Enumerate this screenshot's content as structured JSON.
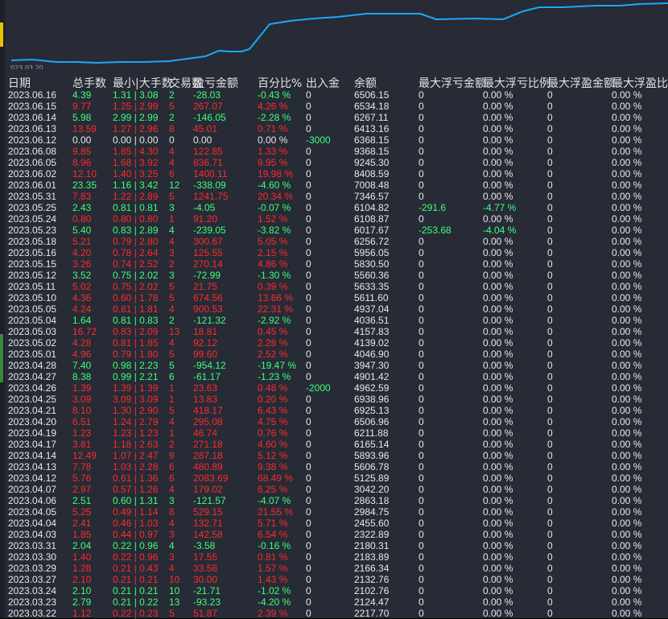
{
  "chart": {
    "x_label": "023.03.20",
    "line_color": "#1ea7ff",
    "points": [
      [
        14,
        75
      ],
      [
        40,
        74
      ],
      [
        70,
        77
      ],
      [
        95,
        77
      ],
      [
        120,
        78
      ],
      [
        150,
        77
      ],
      [
        180,
        77
      ],
      [
        210,
        76
      ],
      [
        240,
        72
      ],
      [
        255,
        70
      ],
      [
        272,
        63
      ],
      [
        285,
        64
      ],
      [
        300,
        64
      ],
      [
        310,
        61
      ],
      [
        335,
        30
      ],
      [
        360,
        26
      ],
      [
        390,
        23
      ],
      [
        420,
        21
      ],
      [
        455,
        17
      ],
      [
        490,
        17
      ],
      [
        522,
        17
      ],
      [
        542,
        24
      ],
      [
        590,
        23
      ],
      [
        625,
        24
      ],
      [
        650,
        14
      ],
      [
        670,
        9
      ],
      [
        700,
        9
      ],
      [
        740,
        7
      ],
      [
        770,
        7
      ],
      [
        795,
        5
      ],
      [
        830,
        4
      ]
    ]
  },
  "header": [
    "日期",
    "总手数",
    "最小|大手数",
    "交易数",
    "盈亏金额",
    "百分比%",
    "出入金",
    "余额",
    "最大浮亏金额",
    "最大浮亏比例",
    "最大浮盈金额",
    "最大浮盈比例"
  ],
  "rows": [
    [
      "2023.06.16",
      "4.39",
      "1.31 | 3.08",
      "2",
      "-28.03",
      "-0.43 %",
      "0",
      "6506.15",
      "0",
      "0.00 %",
      "0",
      "0.00 %"
    ],
    [
      "2023.06.15",
      "9.77",
      "1.25 | 2.99",
      "5",
      "267.07",
      "4.26 %",
      "0",
      "6534.18",
      "0",
      "0.00 %",
      "0",
      "0.00 %"
    ],
    [
      "2023.06.14",
      "5.98",
      "2.99 | 2.99",
      "2",
      "-146.05",
      "-2.28 %",
      "0",
      "6267.11",
      "0",
      "0.00 %",
      "0",
      "0.00 %"
    ],
    [
      "2023.06.13",
      "13.59",
      "1.27 | 2.96",
      "8",
      "45.01",
      "0.71 %",
      "0",
      "6413.16",
      "0",
      "0.00 %",
      "0",
      "0.00 %"
    ],
    [
      "2023.06.12",
      "0.00",
      "0.00 | 0.00",
      "0",
      "0.00",
      "0.00 %",
      "-3000",
      "6368.15",
      "0",
      "0.00 %",
      "0",
      "0.00 %"
    ],
    [
      "2023.06.08",
      "9.85",
      "1.85 | 4.30",
      "4",
      "122.85",
      "1.33 %",
      "0",
      "9368.15",
      "0",
      "0.00 %",
      "0",
      "0.00 %"
    ],
    [
      "2023.06.05",
      "8.96",
      "1.68 | 3.92",
      "4",
      "836.71",
      "9.95 %",
      "0",
      "9245.30",
      "0",
      "0.00 %",
      "0",
      "0.00 %"
    ],
    [
      "2023.06.02",
      "12.10",
      "1.40 | 3.25",
      "6",
      "1400.11",
      "19.98 %",
      "0",
      "8408.59",
      "0",
      "0.00 %",
      "0",
      "0.00 %"
    ],
    [
      "2023.06.01",
      "23.35",
      "1.16 | 3.42",
      "12",
      "-338.09",
      "-4.60 %",
      "0",
      "7008.48",
      "0",
      "0.00 %",
      "0",
      "0.00 %"
    ],
    [
      "2023.05.31",
      "7.83",
      "1.22 | 2.89",
      "5",
      "1241.75",
      "20.34 %",
      "0",
      "7346.57",
      "0",
      "0.00 %",
      "0",
      "0.00 %"
    ],
    [
      "2023.05.25",
      "2.43",
      "0.81 | 0.81",
      "3",
      "-4.05",
      "-0.07 %",
      "0",
      "6104.82",
      "-291.6",
      "-4.77 %",
      "0",
      "0.00 %"
    ],
    [
      "2023.05.24",
      "0.80",
      "0.80 | 0.80",
      "1",
      "91.20",
      "1.52 %",
      "0",
      "6108.87",
      "0",
      "0.00 %",
      "0",
      "0.00 %"
    ],
    [
      "2023.05.23",
      "5.40",
      "0.83 | 2.89",
      "4",
      "-239.05",
      "-3.82 %",
      "0",
      "6017.67",
      "-253.68",
      "-4.04 %",
      "0",
      "0.00 %"
    ],
    [
      "2023.05.18",
      "5.21",
      "0.79 | 2.80",
      "4",
      "300.67",
      "5.05 %",
      "0",
      "6256.72",
      "0",
      "0.00 %",
      "0",
      "0.00 %"
    ],
    [
      "2023.05.16",
      "4.20",
      "0.78 | 2.64",
      "3",
      "125.55",
      "2.15 %",
      "0",
      "5956.05",
      "0",
      "0.00 %",
      "0",
      "0.00 %"
    ],
    [
      "2023.05.15",
      "3.26",
      "0.74 | 2.52",
      "2",
      "270.14",
      "4.86 %",
      "0",
      "5830.50",
      "0",
      "0.00 %",
      "0",
      "0.00 %"
    ],
    [
      "2023.05.12",
      "3.52",
      "0.75 | 2.02",
      "3",
      "-72.99",
      "-1.30 %",
      "0",
      "5560.36",
      "0",
      "0.00 %",
      "0",
      "0.00 %"
    ],
    [
      "2023.05.11",
      "5.02",
      "0.75 | 2.02",
      "5",
      "21.75",
      "0.39 %",
      "0",
      "5633.35",
      "0",
      "0.00 %",
      "0",
      "0.00 %"
    ],
    [
      "2023.05.10",
      "4.36",
      "0.60 | 1.78",
      "5",
      "674.56",
      "13.66 %",
      "0",
      "5611.60",
      "0",
      "0.00 %",
      "0",
      "0.00 %"
    ],
    [
      "2023.05.05",
      "4.24",
      "0.81 | 1.81",
      "4",
      "900.53",
      "22.31 %",
      "0",
      "4937.04",
      "0",
      "0.00 %",
      "0",
      "0.00 %"
    ],
    [
      "2023.05.04",
      "1.64",
      "0.81 | 0.83",
      "2",
      "-121.32",
      "-2.92 %",
      "0",
      "4036.51",
      "0",
      "0.00 %",
      "0",
      "0.00 %"
    ],
    [
      "2023.05.03",
      "16.72",
      "0.83 | 2.09",
      "13",
      "18.81",
      "0.45 %",
      "0",
      "4157.83",
      "0",
      "0.00 %",
      "0",
      "0.00 %"
    ],
    [
      "2023.05.02",
      "4.28",
      "0.81 | 1.85",
      "4",
      "92.12",
      "2.28 %",
      "0",
      "4139.02",
      "0",
      "0.00 %",
      "0",
      "0.00 %"
    ],
    [
      "2023.05.01",
      "4.96",
      "0.79 | 1.80",
      "5",
      "99.60",
      "2.52 %",
      "0",
      "4046.90",
      "0",
      "0.00 %",
      "0",
      "0.00 %"
    ],
    [
      "2023.04.28",
      "7.40",
      "0.98 | 2.23",
      "5",
      "-954.12",
      "-19.47 %",
      "0",
      "3947.30",
      "0",
      "0.00 %",
      "0",
      "0.00 %"
    ],
    [
      "2023.04.27",
      "8.38",
      "0.99 | 2.21",
      "6",
      "-61.17",
      "-1.23 %",
      "0",
      "4901.42",
      "0",
      "0.00 %",
      "0",
      "0.00 %"
    ],
    [
      "2023.04.26",
      "1.39",
      "1.39 | 1.39",
      "1",
      "23.63",
      "0.48 %",
      "-2000",
      "4962.59",
      "0",
      "0.00 %",
      "0",
      "0.00 %"
    ],
    [
      "2023.04.25",
      "3.09",
      "3.09 | 3.09",
      "1",
      "13.83",
      "0.20 %",
      "0",
      "6938.96",
      "0",
      "0.00 %",
      "0",
      "0.00 %"
    ],
    [
      "2023.04.21",
      "8.10",
      "1.30 | 2.90",
      "5",
      "418.17",
      "6.43 %",
      "0",
      "6925.13",
      "0",
      "0.00 %",
      "0",
      "0.00 %"
    ],
    [
      "2023.04.20",
      "6.51",
      "1.24 | 2.79",
      "4",
      "295.08",
      "4.75 %",
      "0",
      "6506.96",
      "0",
      "0.00 %",
      "0",
      "0.00 %"
    ],
    [
      "2023.04.19",
      "1.23",
      "1.23 | 1.23",
      "1",
      "46.74",
      "0.76 %",
      "0",
      "6211.88",
      "0",
      "0.00 %",
      "0",
      "0.00 %"
    ],
    [
      "2023.04.17",
      "3.81",
      "1.18 | 2.63",
      "2",
      "271.18",
      "4.60 %",
      "0",
      "6165.14",
      "0",
      "0.00 %",
      "0",
      "0.00 %"
    ],
    [
      "2023.04.14",
      "12.49",
      "1.07 | 2.47",
      "9",
      "287.18",
      "5.12 %",
      "0",
      "5893.96",
      "0",
      "0.00 %",
      "0",
      "0.00 %"
    ],
    [
      "2023.04.13",
      "7.78",
      "1.03 | 2.28",
      "6",
      "480.89",
      "9.38 %",
      "0",
      "5606.78",
      "0",
      "0.00 %",
      "0",
      "0.00 %"
    ],
    [
      "2023.04.12",
      "5.76",
      "0.61 | 1.36",
      "6",
      "2083.69",
      "68.49 %",
      "0",
      "5125.89",
      "0",
      "0.00 %",
      "0",
      "0.00 %"
    ],
    [
      "2023.04.07",
      "2.97",
      "0.57 | 1.26",
      "4",
      "179.02",
      "6.25 %",
      "0",
      "3042.20",
      "0",
      "0.00 %",
      "0",
      "0.00 %"
    ],
    [
      "2023.04.06",
      "2.51",
      "0.60 | 1.31",
      "3",
      "-121.57",
      "-4.07 %",
      "0",
      "2863.18",
      "0",
      "0.00 %",
      "0",
      "0.00 %"
    ],
    [
      "2023.04.05",
      "5.25",
      "0.49 | 1.14",
      "8",
      "529.15",
      "21.55 %",
      "0",
      "2984.75",
      "0",
      "0.00 %",
      "0",
      "0.00 %"
    ],
    [
      "2023.04.04",
      "2.41",
      "0.46 | 1.03",
      "4",
      "132.71",
      "5.71 %",
      "0",
      "2455.60",
      "0",
      "0.00 %",
      "0",
      "0.00 %"
    ],
    [
      "2023.04.03",
      "1.85",
      "0.44 | 0.97",
      "3",
      "142.58",
      "6.54 %",
      "0",
      "2322.89",
      "0",
      "0.00 %",
      "0",
      "0.00 %"
    ],
    [
      "2023.03.31",
      "2.04",
      "0.22 | 0.96",
      "4",
      "-3.58",
      "-0.16 %",
      "0",
      "2180.31",
      "0",
      "0.00 %",
      "0",
      "0.00 %"
    ],
    [
      "2023.03.30",
      "1.40",
      "0.22 | 0.96",
      "3",
      "17.55",
      "0.81 %",
      "0",
      "2183.89",
      "0",
      "0.00 %",
      "0",
      "0.00 %"
    ],
    [
      "2023.03.29",
      "1.28",
      "0.21 | 0.43",
      "4",
      "33.58",
      "1.57 %",
      "0",
      "2166.34",
      "0",
      "0.00 %",
      "0",
      "0.00 %"
    ],
    [
      "2023.03.27",
      "2.10",
      "0.21 | 0.21",
      "10",
      "30.00",
      "1.43 %",
      "0",
      "2132.76",
      "0",
      "0.00 %",
      "0",
      "0.00 %"
    ],
    [
      "2023.03.24",
      "2.10",
      "0.21 | 0.21",
      "10",
      "-21.71",
      "-1.02 %",
      "0",
      "2102.76",
      "0",
      "0.00 %",
      "0",
      "0.00 %"
    ],
    [
      "2023.03.23",
      "2.79",
      "0.21 | 0.22",
      "13",
      "-93.23",
      "-4.20 %",
      "0",
      "2124.47",
      "0",
      "0.00 %",
      "0",
      "0.00 %"
    ],
    [
      "2023.03.22",
      "1.12",
      "0.22 | 0.23",
      "5",
      "51.87",
      "2.39 %",
      "0",
      "2217.70",
      "0",
      "0.00 %",
      "0",
      "0.00 %"
    ]
  ]
}
